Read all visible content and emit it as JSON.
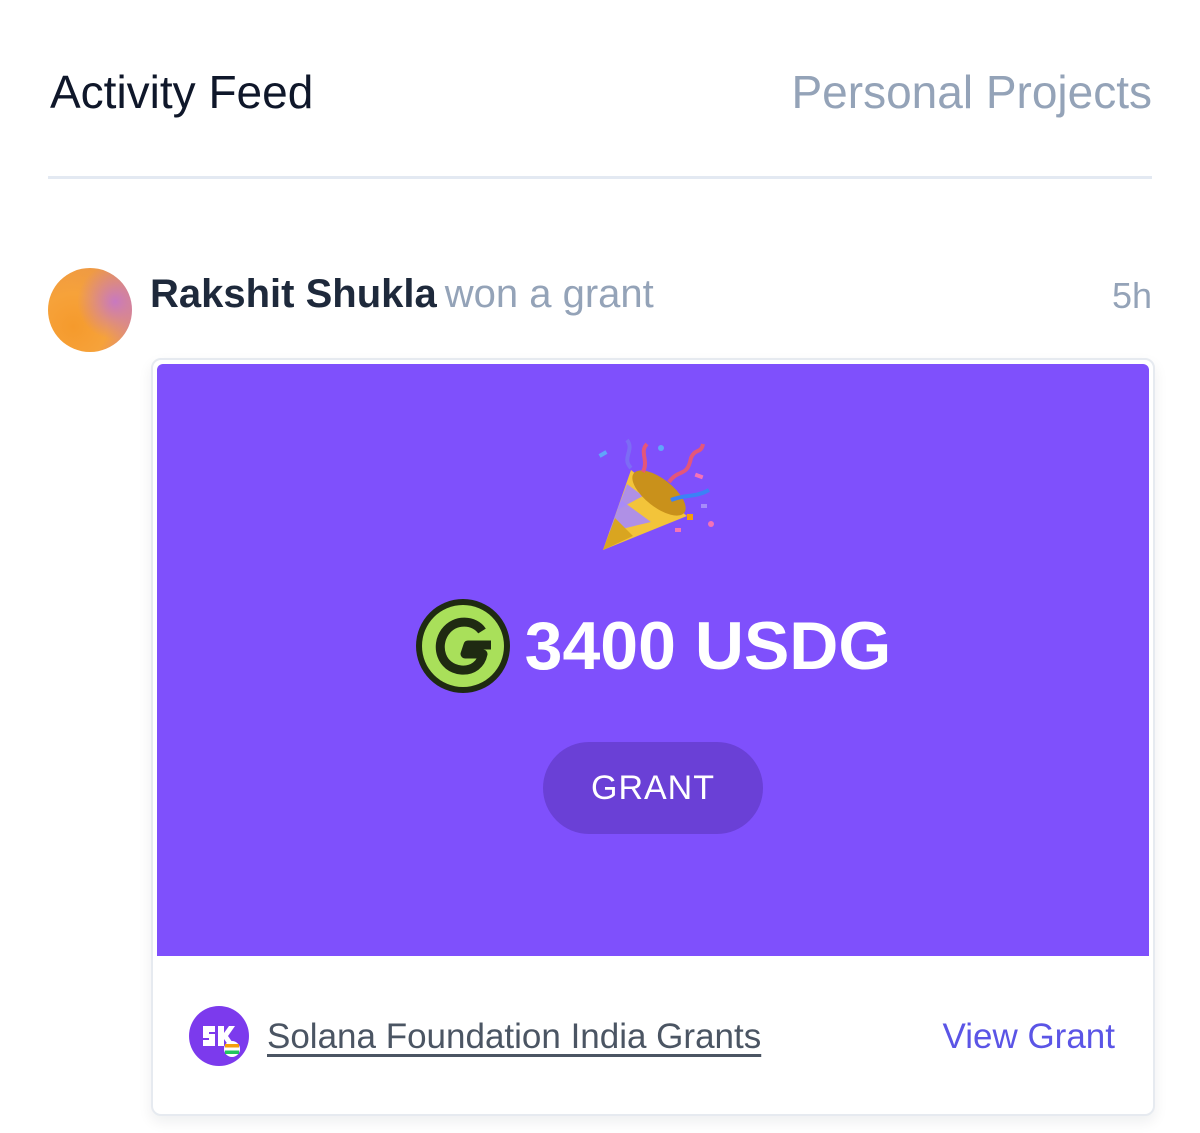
{
  "tabs": {
    "active": "Activity Feed",
    "inactive": "Personal Projects"
  },
  "feed_item": {
    "user_name": "Rakshit Shukla",
    "action": "won a grant",
    "time": "5h",
    "avatar_icon": "gradient-avatar",
    "card": {
      "banner_color": "#7f50fc",
      "celebration_icon": "party-popper-icon",
      "token_icon": "usdg-token-icon",
      "amount": "3400 USDG",
      "type_label": "GRANT",
      "sponsor_icon": "superteam-india-logo",
      "sponsor_name": "Solana Foundation India Grants",
      "view_label": "View Grant"
    }
  },
  "colors": {
    "accent": "#5b55e6",
    "muted": "#94a3b8",
    "heading": "#0f172a"
  }
}
